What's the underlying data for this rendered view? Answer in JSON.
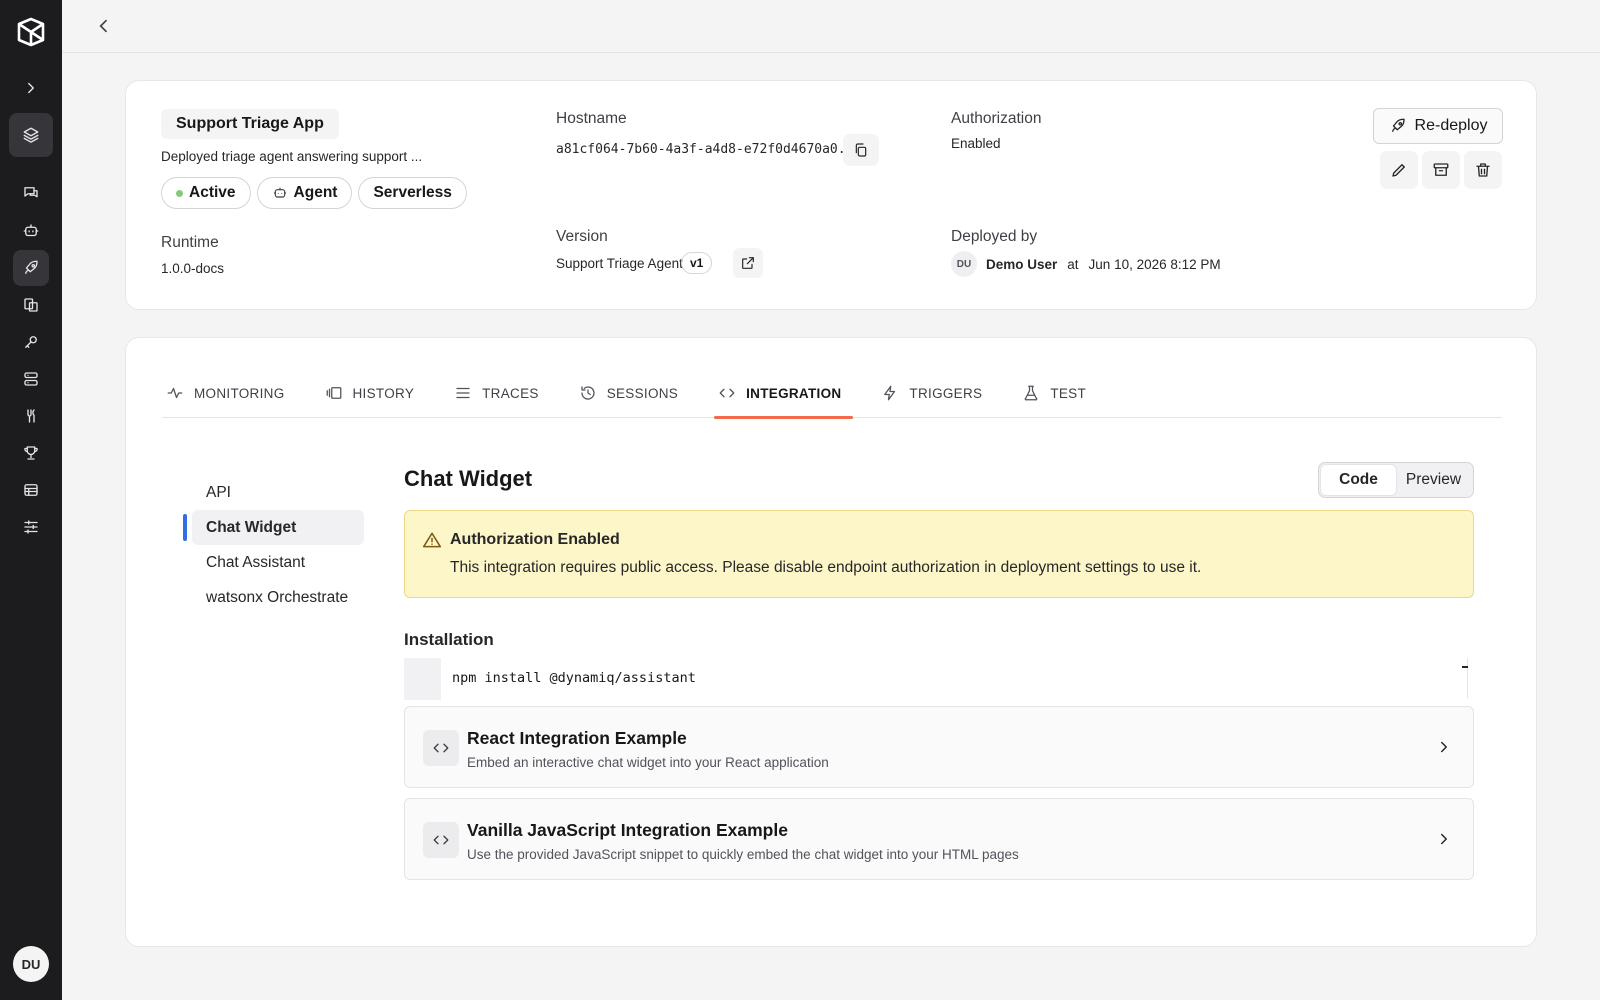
{
  "user": {
    "initials": "DU"
  },
  "app": {
    "name": "Support Triage App",
    "description": "Deployed triage agent answering support ...",
    "chips": {
      "status": "Active",
      "type": "Agent",
      "infra": "Serverless"
    },
    "runtime": {
      "label": "Runtime",
      "value": "1.0.0-docs"
    },
    "hostname": {
      "label": "Hostname",
      "value": "a81cf064-7b60-4a3f-a4d8-e72f0d4670a0..."
    },
    "version": {
      "label": "Version",
      "agent": "Support Triage Agent",
      "badge": "v1"
    },
    "authorization": {
      "label": "Authorization",
      "value": "Enabled"
    },
    "deployed_by": {
      "label": "Deployed by",
      "initials": "DU",
      "user": "Demo User",
      "at": "at",
      "date": "Jun 10, 2026 8:12 PM"
    },
    "redeploy_label": "Re-deploy"
  },
  "tabs": [
    {
      "label": "MONITORING",
      "icon": "activity-icon"
    },
    {
      "label": "HISTORY",
      "icon": "history-icon"
    },
    {
      "label": "TRACES",
      "icon": "list-icon"
    },
    {
      "label": "SESSIONS",
      "icon": "clock-history-icon"
    },
    {
      "label": "INTEGRATION",
      "icon": "code-icon"
    },
    {
      "label": "TRIGGERS",
      "icon": "bolt-icon"
    },
    {
      "label": "TEST",
      "icon": "flask-icon"
    }
  ],
  "subnav": [
    "API",
    "Chat Widget",
    "Chat Assistant",
    "watsonx Orchestrate"
  ],
  "section": {
    "title": "Chat Widget",
    "toggle": {
      "code": "Code",
      "preview": "Preview"
    },
    "alert": {
      "title": "Authorization Enabled",
      "message": "This integration requires public access. Please disable endpoint authorization in deployment settings to use it."
    },
    "installation": {
      "title": "Installation",
      "command": "npm install @dynamiq/assistant"
    },
    "examples": [
      {
        "title": "React Integration Example",
        "description": "Embed an interactive chat widget into your React application"
      },
      {
        "title": "Vanilla JavaScript Integration Example",
        "description": "Use the provided JavaScript snippet to quickly embed the chat widget into your HTML pages"
      }
    ]
  },
  "colors": {
    "accent_tab": "#f26b4b",
    "subnav_indicator": "#2f6fe4",
    "alert_bg": "#fdf6c8",
    "status_dot": "#86c97b"
  }
}
